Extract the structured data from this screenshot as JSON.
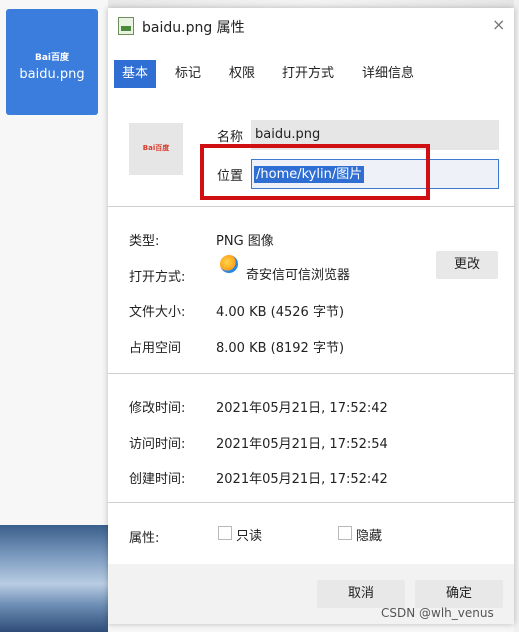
{
  "desktop": {
    "icon_label": "baidu.png",
    "icon_logo_text": "Bai百度"
  },
  "dialog": {
    "title": "baidu.png 属性",
    "close_glyph": "×",
    "tabs": [
      {
        "label": "基本",
        "active": true
      },
      {
        "label": "标记",
        "active": false
      },
      {
        "label": "权限",
        "active": false
      },
      {
        "label": "打开方式",
        "active": false
      },
      {
        "label": "详细信息",
        "active": false
      }
    ],
    "thumbnail_logo_text": "Bai百度",
    "name_label": "名称",
    "name_value": "baidu.png",
    "location_label": "位置",
    "location_value": "/home/kylin/图片",
    "info": {
      "type_label": "类型:",
      "type_value": "PNG 图像",
      "open_with_label": "打开方式:",
      "open_with_value": "奇安信可信浏览器",
      "change_button": "更改",
      "size_label": "文件大小:",
      "size_value": "4.00 KB (4526 字节)",
      "disk_label": "占用空间",
      "disk_value": "8.00 KB (8192 字节)"
    },
    "times": {
      "modified_label": "修改时间:",
      "modified_value": "2021年05月21日, 17:52:42",
      "accessed_label": "访问时间:",
      "accessed_value": "2021年05月21日, 17:52:54",
      "created_label": "创建时间:",
      "created_value": "2021年05月21日, 17:52:42"
    },
    "attributes": {
      "label": "属性:",
      "readonly": "只读",
      "hidden": "隐藏"
    },
    "buttons": {
      "cancel": "取消",
      "ok": "确定"
    }
  },
  "watermark": "CSDN @wlh_venus",
  "colors": {
    "accent": "#2f6fd4",
    "highlight_box": "#d00f12",
    "desktop_icon_bg": "#3b7ddd"
  }
}
